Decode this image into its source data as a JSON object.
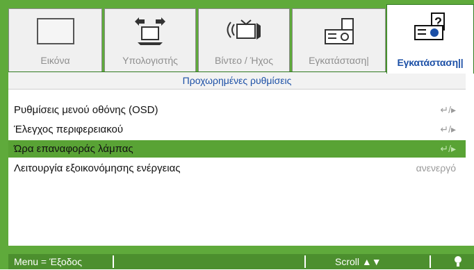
{
  "tabs": [
    {
      "label": "Εικόνα",
      "icon": "display-icon"
    },
    {
      "label": "Υπολογιστής",
      "icon": "computer-icon"
    },
    {
      "label": "Βίντεο / Ήχος",
      "icon": "video-audio-icon"
    },
    {
      "label": "Εγκατάσταση|",
      "icon": "projector-settings-icon"
    },
    {
      "label": "Εγκατάσταση||",
      "icon": "projector-advanced-icon",
      "active": true
    }
  ],
  "subheader": "Προχωρημένες ρυθμίσεις",
  "rows": [
    {
      "label": "Ρυθμίσεις μενού οθόνης (OSD)",
      "value": "↵/▸"
    },
    {
      "label": "Έλεγχος περιφερειακού",
      "value": "↵/▸"
    },
    {
      "label": "Ώρα επαναφοράς λάμπας",
      "value": "↵/▸",
      "selected": true
    },
    {
      "label": "Λειτουργία εξοικονόμησης ενέργειας",
      "value": "ανενεργό"
    }
  ],
  "footer": {
    "menu": "Menu = Έξοδος",
    "scroll": "Scroll ▲▼"
  },
  "colors": {
    "accent_green": "#5faa3b",
    "selection_green": "#59a335",
    "title_blue": "#1b4fa6"
  }
}
